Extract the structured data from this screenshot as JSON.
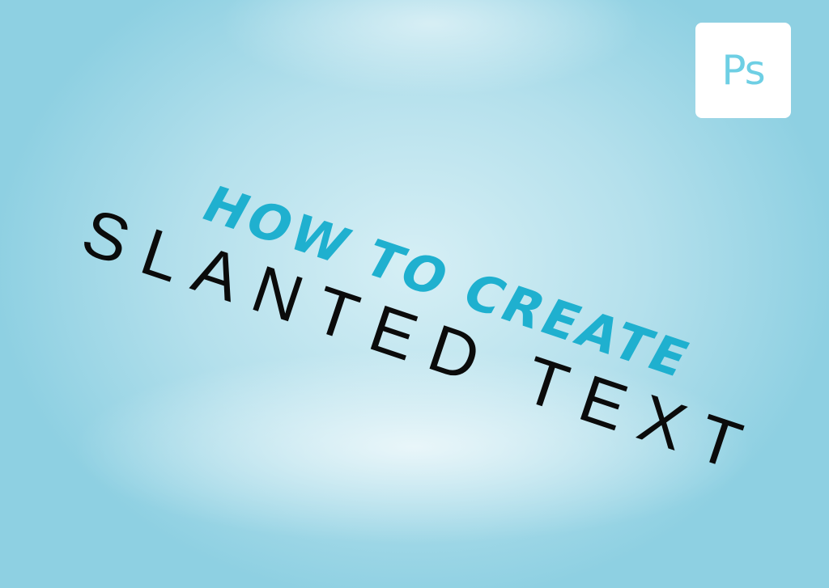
{
  "logo": {
    "text": "Ps",
    "text_color": "#6ecfe4",
    "background": "#ffffff"
  },
  "title": {
    "line1": "HOW TO CREATE",
    "line2": "SLANTED TEXT",
    "line1_color": "#1fb0cf",
    "line2_color": "#0b0b0b"
  },
  "background_color": "#b4e0ec"
}
